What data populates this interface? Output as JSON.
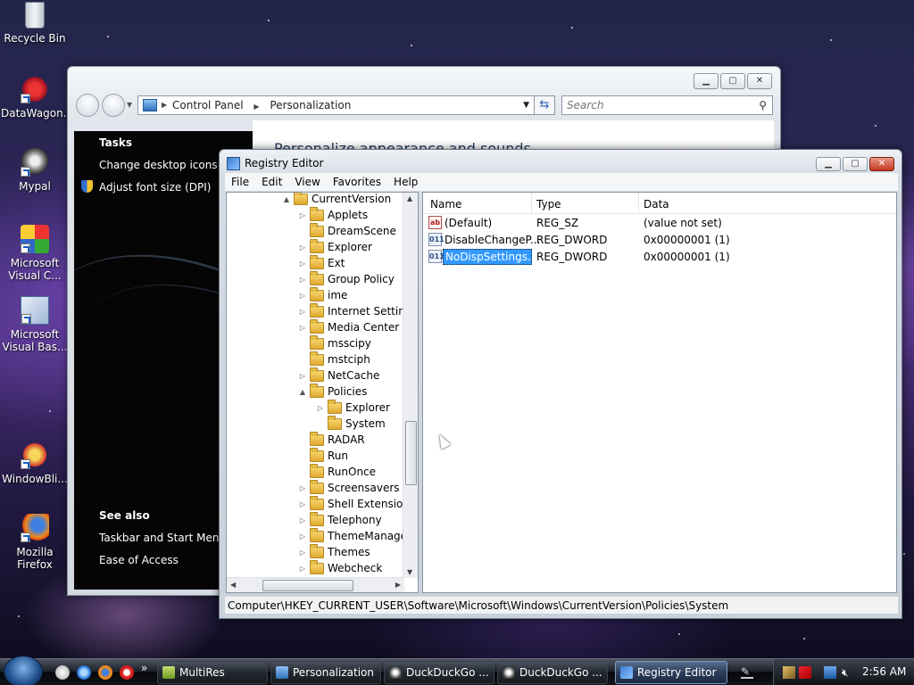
{
  "desktop": {
    "icons": [
      {
        "label": "Recycle Bin",
        "icon": "recycle-bin-icon"
      },
      {
        "label": "DataWagon...",
        "icon": "datawagon-icon"
      },
      {
        "label": "Mypal",
        "icon": "mypal-icon"
      },
      {
        "label": "Microsoft Visual C...",
        "icon": "visual-c-icon"
      },
      {
        "label": "Microsoft Visual Bas...",
        "icon": "visual-basic-icon"
      },
      {
        "label": "WindowBli...",
        "icon": "windowblinds-icon"
      },
      {
        "label": "Mozilla Firefox",
        "icon": "firefox-icon"
      }
    ]
  },
  "control_panel": {
    "breadcrumb": [
      "Control Panel",
      "Personalization"
    ],
    "search_placeholder": "Search",
    "tasks_heading": "Tasks",
    "tasks": [
      "Change desktop icons",
      "Adjust font size (DPI)"
    ],
    "see_also_heading": "See also",
    "see_also": [
      "Taskbar and Start Menu",
      "Ease of Access"
    ],
    "main_title": "Personalize appearance and sounds"
  },
  "regedit": {
    "title": "Registry Editor",
    "menu": [
      "File",
      "Edit",
      "View",
      "Favorites",
      "Help"
    ],
    "tree": [
      {
        "label": "CurrentVersion",
        "expander": "▲",
        "level": 0
      },
      {
        "label": "Applets",
        "expander": "▷",
        "level": 1
      },
      {
        "label": "DreamScene",
        "expander": "",
        "level": 1
      },
      {
        "label": "Explorer",
        "expander": "▷",
        "level": 1
      },
      {
        "label": "Ext",
        "expander": "▷",
        "level": 1
      },
      {
        "label": "Group Policy",
        "expander": "▷",
        "level": 1
      },
      {
        "label": "ime",
        "expander": "▷",
        "level": 1
      },
      {
        "label": "Internet Setting",
        "expander": "▷",
        "level": 1
      },
      {
        "label": "Media Center",
        "expander": "▷",
        "level": 1
      },
      {
        "label": "msscipy",
        "expander": "",
        "level": 1
      },
      {
        "label": "mstciph",
        "expander": "",
        "level": 1
      },
      {
        "label": "NetCache",
        "expander": "▷",
        "level": 1
      },
      {
        "label": "Policies",
        "expander": "▲",
        "level": 1
      },
      {
        "label": "Explorer",
        "expander": "▷",
        "level": 2
      },
      {
        "label": "System",
        "expander": "",
        "level": 2
      },
      {
        "label": "RADAR",
        "expander": "",
        "level": 1
      },
      {
        "label": "Run",
        "expander": "",
        "level": 1
      },
      {
        "label": "RunOnce",
        "expander": "",
        "level": 1
      },
      {
        "label": "Screensavers",
        "expander": "▷",
        "level": 1
      },
      {
        "label": "Shell Extension",
        "expander": "▷",
        "level": 1
      },
      {
        "label": "Telephony",
        "expander": "▷",
        "level": 1
      },
      {
        "label": "ThemeManage",
        "expander": "▷",
        "level": 1
      },
      {
        "label": "Themes",
        "expander": "▷",
        "level": 1
      },
      {
        "label": "Webcheck",
        "expander": "▷",
        "level": 1
      }
    ],
    "columns": [
      "Name",
      "Type",
      "Data"
    ],
    "values": [
      {
        "name": "(Default)",
        "type": "REG_SZ",
        "data": "(value not set)",
        "icon": "ab"
      },
      {
        "name": "DisableChangeP...",
        "type": "REG_DWORD",
        "data": "0x00000001 (1)",
        "icon": "011"
      },
      {
        "name": "NoDispSettings...",
        "type": "REG_DWORD",
        "data": "0x00000001 (1)",
        "icon": "011"
      }
    ],
    "status": "Computer\\HKEY_CURRENT_USER\\Software\\Microsoft\\Windows\\CurrentVersion\\Policies\\System"
  },
  "taskbar": {
    "buttons": [
      "MultiRes",
      "Personalization",
      "DuckDuckGo ...",
      "DuckDuckGo ...",
      "Registry Editor"
    ],
    "clock": "2:56 AM",
    "overflow": "»"
  }
}
